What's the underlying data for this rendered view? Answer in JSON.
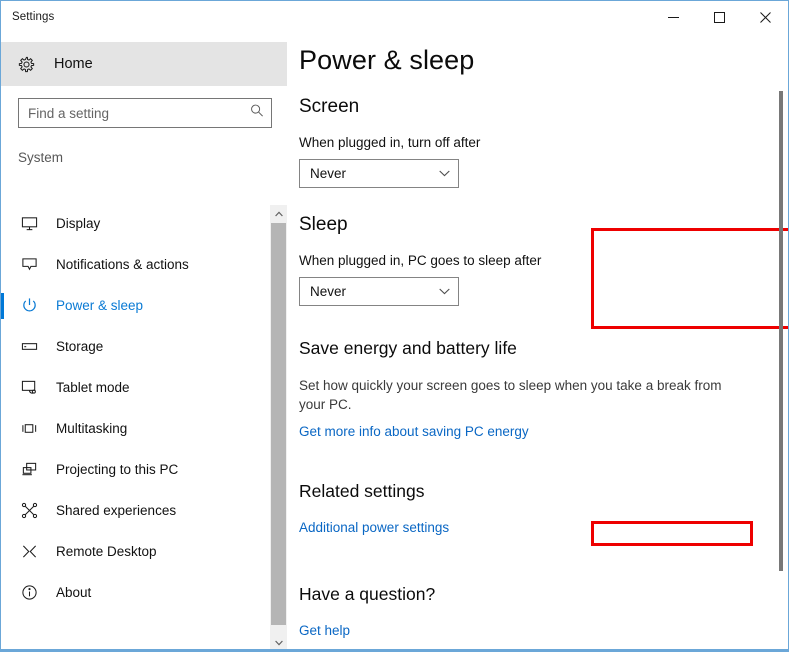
{
  "window": {
    "title": "Settings",
    "controls": {
      "minimize": "minimize",
      "maximize": "maximize",
      "close": "close"
    },
    "accent_border": "#6ba7d8"
  },
  "sidebar": {
    "home": {
      "label": "Home",
      "icon": "gear-icon"
    },
    "search": {
      "value": "",
      "placeholder": "Find a setting",
      "icon": "search-icon"
    },
    "group_title": "System",
    "items": [
      {
        "label": "Display",
        "icon": "monitor-icon",
        "selected": false
      },
      {
        "label": "Notifications & actions",
        "icon": "notification-icon",
        "selected": false
      },
      {
        "label": "Power & sleep",
        "icon": "power-icon",
        "selected": true
      },
      {
        "label": "Storage",
        "icon": "storage-icon",
        "selected": false
      },
      {
        "label": "Tablet mode",
        "icon": "tablet-icon",
        "selected": false
      },
      {
        "label": "Multitasking",
        "icon": "multitasking-icon",
        "selected": false
      },
      {
        "label": "Projecting to this PC",
        "icon": "projecting-icon",
        "selected": false
      },
      {
        "label": "Shared experiences",
        "icon": "shared-experiences-icon",
        "selected": false
      },
      {
        "label": "Remote Desktop",
        "icon": "remote-desktop-icon",
        "selected": false
      },
      {
        "label": "About",
        "icon": "info-icon",
        "selected": false
      }
    ],
    "selected_accent": "#0078d7"
  },
  "main": {
    "page_title": "Power & sleep",
    "screen": {
      "heading": "Screen",
      "field_label": "When plugged in, turn off after",
      "dropdown_value": "Never"
    },
    "sleep": {
      "heading": "Sleep",
      "field_label": "When plugged in, PC goes to sleep after",
      "dropdown_value": "Never"
    },
    "save_energy": {
      "heading": "Save energy and battery life",
      "description": "Set how quickly your screen goes to sleep when you take a break from your PC.",
      "link": "Get more info about saving PC energy"
    },
    "related": {
      "heading": "Related settings",
      "link": "Additional power settings"
    },
    "question": {
      "heading": "Have a question?",
      "link": "Get help"
    }
  },
  "annotations": {
    "color": "#ee0000",
    "boxes": [
      {
        "name": "sleep-section-highlight"
      },
      {
        "name": "additional-power-settings-highlight"
      }
    ]
  }
}
